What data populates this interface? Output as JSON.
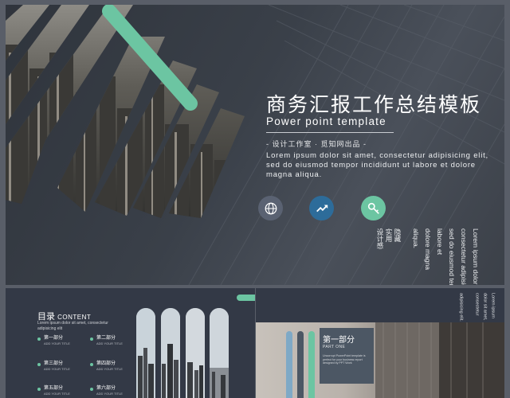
{
  "hero": {
    "title": "商务汇报工作总结模板",
    "subtitle": "Power  point  template",
    "studio": "- 设计工作室 · 觅知网出品 -",
    "lorem": "Lorem ipsum dolor sit amet, consectetur adipisicing elit, sed do eiusmod tempor incididunt ut labore et dolore magna aliqua.",
    "icons": [
      {
        "name": "globe-icon",
        "color": "#5a6272"
      },
      {
        "name": "trend-up-icon",
        "color": "#2d6c9a"
      },
      {
        "name": "key-icon",
        "color": "#6cc5a2"
      }
    ],
    "vertical_texts": [
      "Lorem ipsum dolor sit amet,",
      "consectetur adipisicing elit,",
      "sed do eiusmod tempor incididunt ut",
      "labore et",
      "dolore magna",
      "aliqua.",
      "隐藏",
      "实用",
      "设计感"
    ]
  },
  "thumb_left": {
    "title_cn": "目录",
    "title_en": "CONTENT",
    "desc": "Lorem ipsum dolor sit amet, consectetur adipisicing elit",
    "items": [
      {
        "label": "第一部分",
        "sub": "ADD YOUR TITLE"
      },
      {
        "label": "第二部分",
        "sub": "ADD YOUR TITLE"
      },
      {
        "label": "第三部分",
        "sub": "ADD YOUR TITLE"
      },
      {
        "label": "第四部分",
        "sub": "ADD YOUR TITLE"
      },
      {
        "label": "第五部分",
        "sub": "ADD YOUR TITLE"
      },
      {
        "label": "第六部分",
        "sub": "ADD YOUR TITLE"
      }
    ]
  },
  "thumb_right": {
    "vertical_texts": [
      "Lorem ipsum",
      "dolor sit amet,",
      "consectetur",
      "adipisicing elit."
    ],
    "part_cn": "第一部分",
    "part_en": "PART ONE",
    "part_text": "Uncorrupt PowerPoint template is perfect for your business report designed by PPT Work",
    "accent": "#6cc5a2"
  },
  "colors": {
    "accent": "#6cc5a2",
    "dark": "#333946",
    "blue": "#2d6c9a"
  }
}
